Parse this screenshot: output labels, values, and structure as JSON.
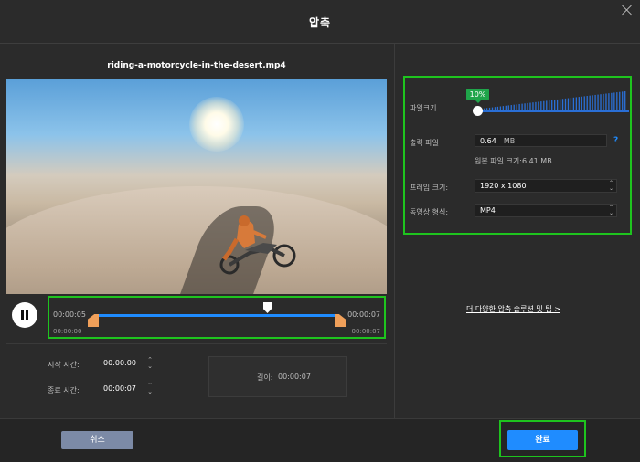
{
  "window": {
    "title": "압축"
  },
  "preview": {
    "filename": "riding-a-motorcycle-in-the-desert.mp4"
  },
  "timeline": {
    "current_time": "00:00:05",
    "total_time": "00:00:07",
    "start_marker": "00:00:00",
    "end_marker": "00:00:07"
  },
  "trim": {
    "start_label": "시작 시간:",
    "start_value": "00:00:00",
    "end_label": "종료 시간:",
    "end_value": "00:00:07",
    "duration_label": "길이:",
    "duration_value": "00:00:07"
  },
  "settings": {
    "file_size_label": "파일크기",
    "file_size_percent": "10%",
    "output_file_label": "출력 파일",
    "output_size_value": "0.64",
    "output_size_unit": "MB",
    "help_icon": "?",
    "original_size": "원본 파일 크기:6.41 MB",
    "frame_size_label": "프레임 크기:",
    "frame_size_value": "1920 x 1080",
    "format_label": "동영상 형식:",
    "format_value": "MP4"
  },
  "tips_link": "더 다양한 압축 솔루션 및 팁 >",
  "footer": {
    "cancel_label": "취소",
    "done_label": "완료"
  },
  "colors": {
    "accent": "#1f8cff",
    "highlight": "#1ec41e",
    "badge": "#1fa54a",
    "handle": "#f0a05a"
  }
}
